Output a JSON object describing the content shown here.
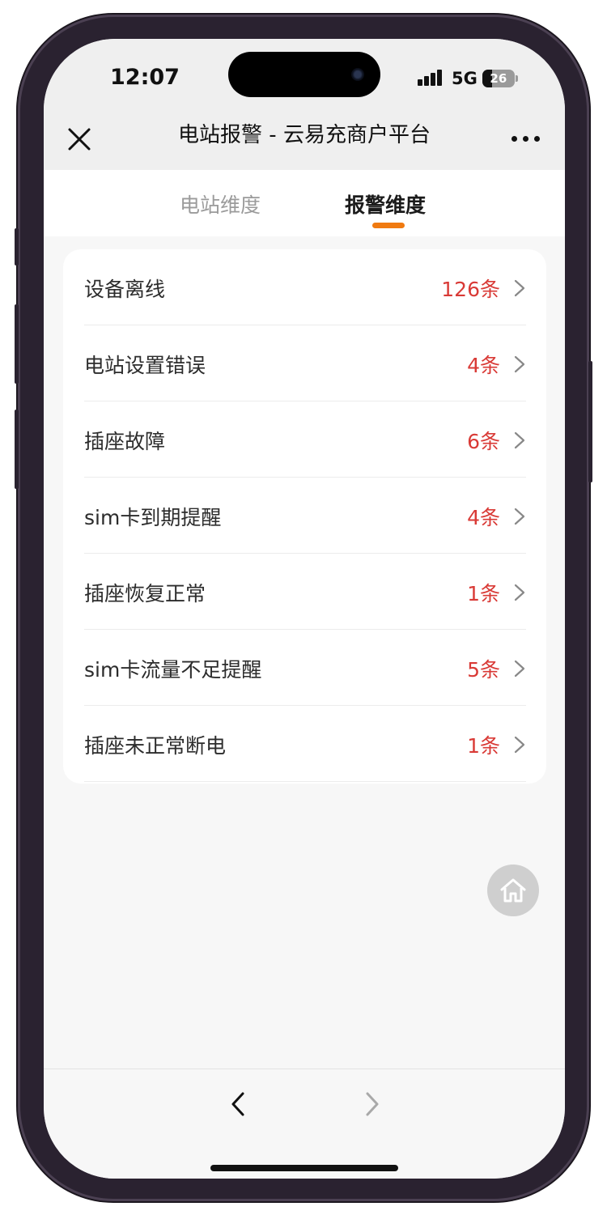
{
  "status_bar": {
    "time": "12:07",
    "network": "5G",
    "battery": "26"
  },
  "header": {
    "title": "电站报警 - 云易充商户平台",
    "close_icon": "close-icon",
    "more_icon": "more-icon"
  },
  "tabs": [
    {
      "label": "电站维度",
      "active": false
    },
    {
      "label": "报警维度",
      "active": true
    }
  ],
  "colors": {
    "accent": "#f07a10",
    "count_red": "#d93a36"
  },
  "alarms": [
    {
      "label": "设备离线",
      "count": "126条"
    },
    {
      "label": "电站设置错误",
      "count": "4条"
    },
    {
      "label": "插座故障",
      "count": "6条"
    },
    {
      "label": "sim卡到期提醒",
      "count": "4条"
    },
    {
      "label": "插座恢复正常",
      "count": "1条"
    },
    {
      "label": "sim卡流量不足提醒",
      "count": "5条"
    },
    {
      "label": "插座未正常断电",
      "count": "1条"
    }
  ],
  "floating": {
    "icon": "home-icon"
  },
  "bottom_nav": {
    "back_icon": "chevron-left-icon",
    "forward_icon": "chevron-right-icon"
  }
}
